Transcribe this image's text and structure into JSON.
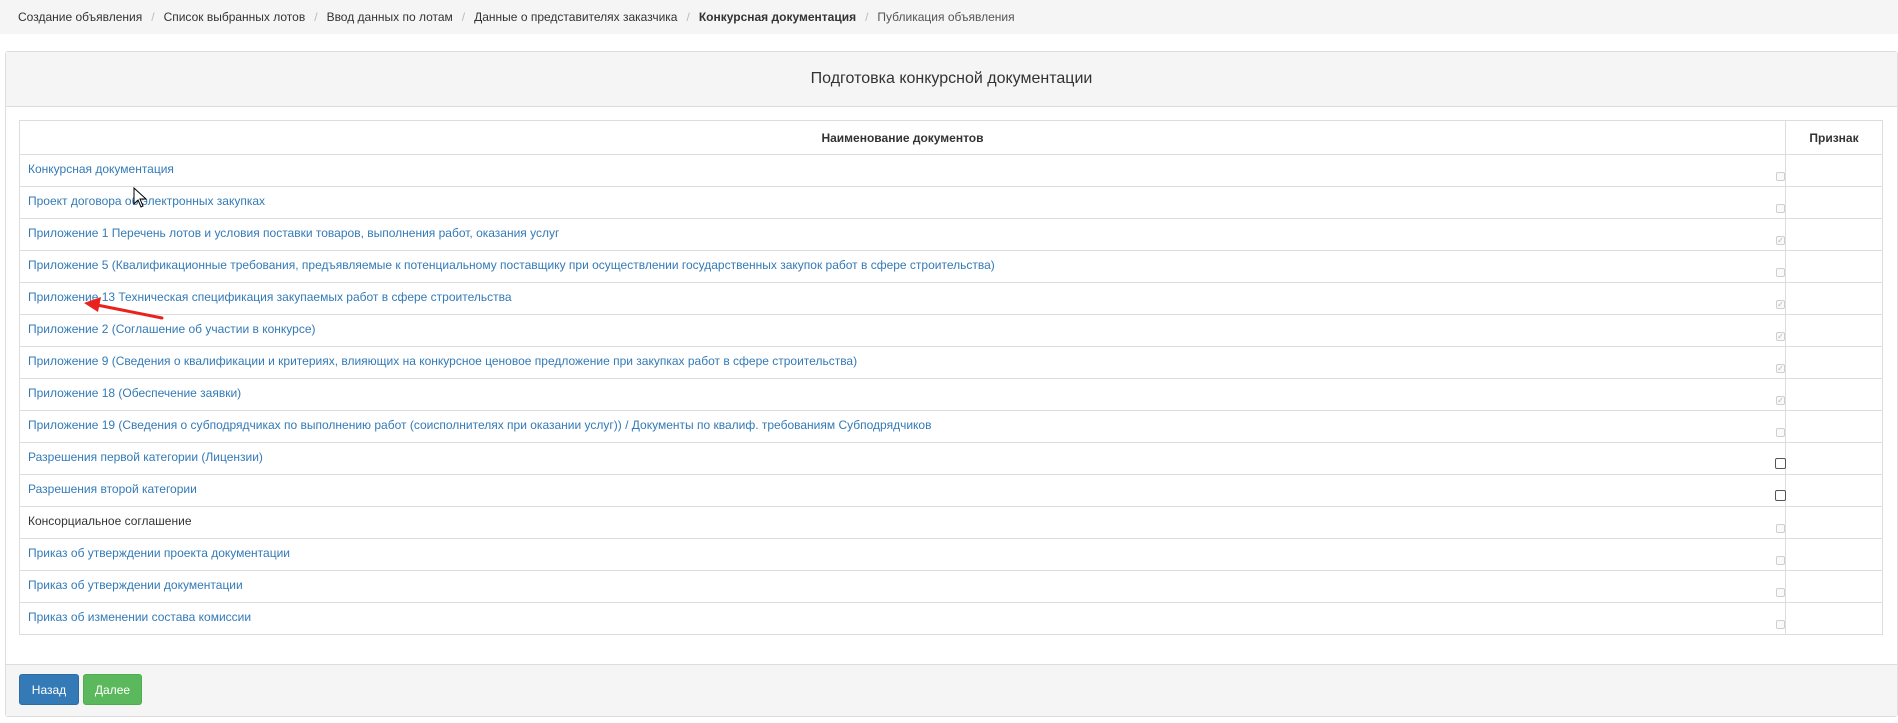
{
  "breadcrumb": [
    {
      "label": "Создание объявления"
    },
    {
      "label": "Список выбранных лотов"
    },
    {
      "label": "Ввод данных по лотам"
    },
    {
      "label": "Данные о представителях заказчика"
    },
    {
      "label": "Конкурсная документация"
    },
    {
      "label": "Публикация объявления"
    }
  ],
  "panel": {
    "title": "Подготовка конкурсной документации"
  },
  "table": {
    "headers": {
      "name": "Наименование документов",
      "flag": "Признак"
    },
    "rows": [
      {
        "name": "Конкурсная документация",
        "link": true,
        "checked": false,
        "disabled": true
      },
      {
        "name": "Проект договора об электронных закупках",
        "link": true,
        "checked": false,
        "disabled": true
      },
      {
        "name": "Приложение 1 Перечень лотов и условия поставки товаров, выполнения работ, оказания услуг",
        "link": true,
        "checked": true,
        "disabled": true
      },
      {
        "name": "Приложение 5 (Квалификационные требования, предъявляемые к потенциальному поставщику при осуществлении государственных закупок работ в сфере строительства)",
        "link": true,
        "checked": false,
        "disabled": true
      },
      {
        "name": "Приложение 13 Техническая спецификация закупаемых работ в сфере строительства",
        "link": true,
        "checked": true,
        "disabled": true
      },
      {
        "name": "Приложение 2 (Соглашение об участии в конкурсе)",
        "link": true,
        "checked": true,
        "disabled": true
      },
      {
        "name": "Приложение 9 (Сведения о квалификации и критериях, влияющих на конкурсное ценовое предложение при закупках работ в сфере строительства)",
        "link": true,
        "checked": true,
        "disabled": true
      },
      {
        "name": "Приложение 18 (Обеспечение заявки)",
        "link": true,
        "checked": true,
        "disabled": true
      },
      {
        "name": "Приложение 19 (Сведения о субподрядчиках по выполнению работ (соисполнителях при оказании услуг)) / Документы по квалиф. требованиям Субподрядчиков",
        "link": true,
        "checked": false,
        "disabled": true
      },
      {
        "name": "Разрешения первой категории (Лицензии)",
        "link": true,
        "checked": false,
        "disabled": false
      },
      {
        "name": "Разрешения второй категории",
        "link": true,
        "checked": false,
        "disabled": false
      },
      {
        "name": "Консорциальное соглашение",
        "link": false,
        "checked": false,
        "disabled": true
      },
      {
        "name": "Приказ об утверждении проекта документации",
        "link": true,
        "checked": false,
        "disabled": true
      },
      {
        "name": "Приказ об утверждении документации",
        "link": true,
        "checked": false,
        "disabled": true
      },
      {
        "name": "Приказ об изменении состава комиссии",
        "link": true,
        "checked": false,
        "disabled": true
      }
    ]
  },
  "footer": {
    "back_label": "Назад",
    "next_label": "Далее"
  },
  "colors": {
    "link": "#337ab7",
    "primary": "#337ab7",
    "success": "#5cb85c",
    "annotation_arrow": "#e8231f"
  },
  "icons": {
    "checkbox_checked": "check-mark",
    "cursor": "mouse-pointer-icon",
    "annotation": "red-arrow-icon"
  }
}
